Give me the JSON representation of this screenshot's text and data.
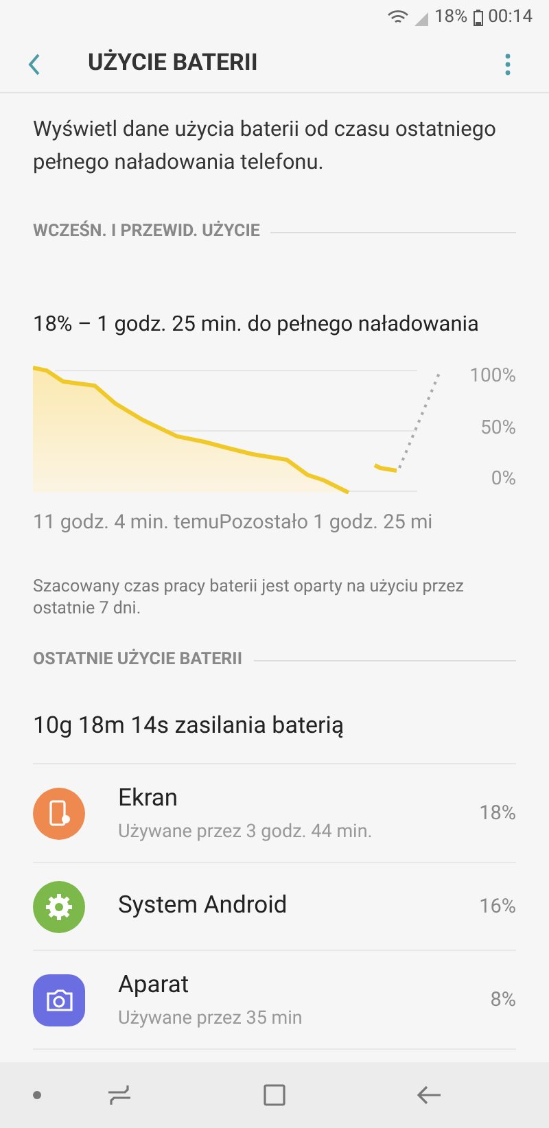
{
  "status_bar": {
    "battery": "18%",
    "time": "00:14"
  },
  "header": {
    "title": "UŻYCIE BATERII"
  },
  "description": "Wyświetl dane użycia baterii od czasu ostatniego pełnego naładowania telefonu.",
  "usage_section": {
    "title": "WCZEŚN. I PRZEWID. UŻYCIE",
    "charging": "18% – 1 godz. 25 min. do pełnego naładowania",
    "axis_labels": [
      "100%",
      "50%",
      "0%"
    ],
    "start_label": "11 godz. 4 min. temu",
    "end_label": "Pozostało 1 godz. 25 mi",
    "note": "Szacowany czas pracy baterii jest oparty na użyciu przez ostatnie 7 dni."
  },
  "recent_section": {
    "title": "OSTATNIE UŻYCIE BATERII",
    "summary": "10g 18m 14s zasilania baterią"
  },
  "apps": [
    {
      "kind": "screen",
      "name": "Ekran",
      "detail": "Używane przez 3 godz. 44 min.",
      "percent": "18%",
      "color": "#ee8a4f"
    },
    {
      "kind": "system",
      "name": "System Android",
      "percent": "16%",
      "color": "#7cb84a"
    },
    {
      "kind": "camera",
      "name": "Aparat",
      "detail": "Używane przez 35 min",
      "percent": "8%",
      "color": "#6a6ee0"
    }
  ]
}
